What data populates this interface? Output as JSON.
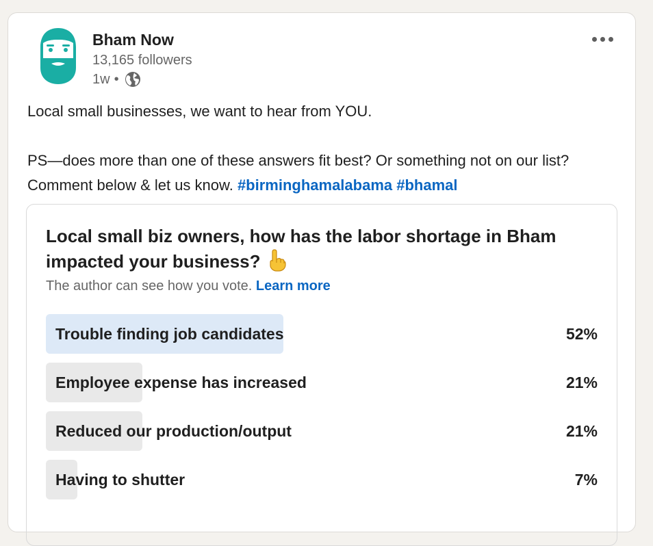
{
  "author": {
    "name": "Bham Now",
    "followers": "13,165 followers",
    "time": "1w",
    "separator": "•",
    "avatar_icon": "bearded-man-logo-icon",
    "visibility_icon": "globe-icon"
  },
  "menu": {
    "icon": "more-horizontal-icon"
  },
  "post": {
    "line1": "Local small businesses, we want to hear from YOU.",
    "line2": "PS—does more than one of these answers fit best? Or something not on our list? Comment below & let us know.",
    "hashtags": [
      "#birminghamalabama",
      "#bhamal"
    ]
  },
  "poll": {
    "question": "Local small biz owners, how has the labor shortage in Bham impacted your business?",
    "question_emoji": "pointing-down-icon",
    "note": "The author can see how you vote.",
    "learn_more": "Learn more",
    "options": [
      {
        "label": "Trouble finding job candidates",
        "percent": "52%",
        "fraction": 0.43,
        "highlight": true
      },
      {
        "label": "Employee expense has increased",
        "percent": "21%",
        "fraction": 0.175,
        "highlight": false
      },
      {
        "label": "Reduced our production/output",
        "percent": "21%",
        "fraction": 0.175,
        "highlight": false
      },
      {
        "label": "Having to shutter",
        "percent": "7%",
        "fraction": 0.057,
        "highlight": false
      }
    ]
  },
  "colors": {
    "link": "#0a66c2",
    "brand_teal": "#1aaea4",
    "bar_winner": "#dde9f7",
    "bar_other": "#e9e9e9"
  }
}
